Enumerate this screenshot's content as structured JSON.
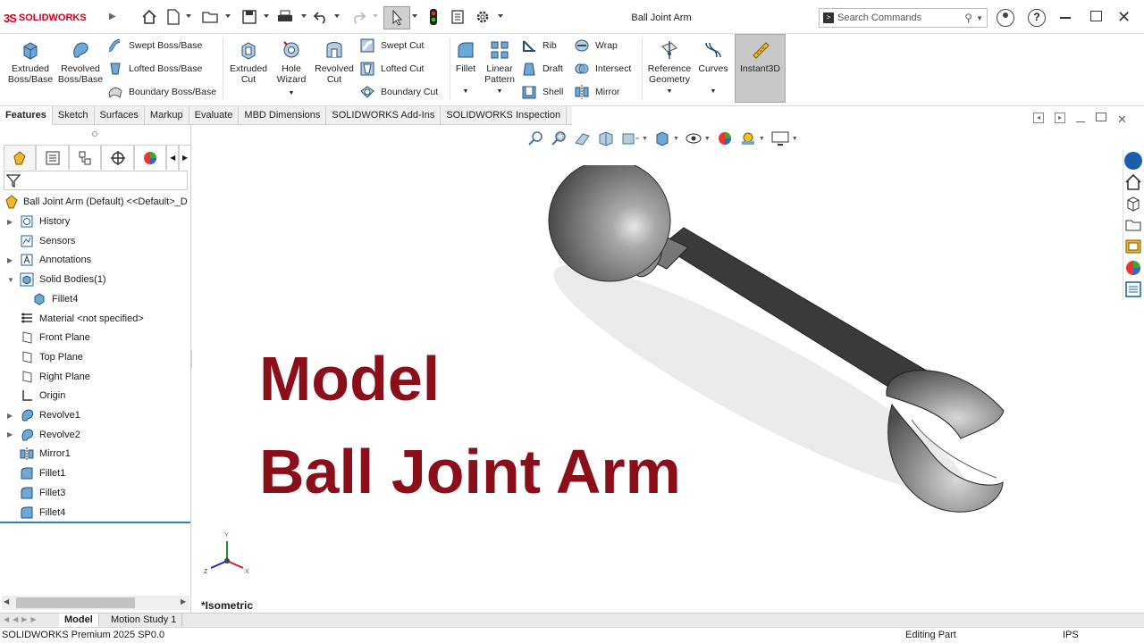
{
  "titlebar": {
    "brand_prefix": "3S",
    "brand_name": "SOLIDWORKS",
    "title": "Ball Joint Arm",
    "search_placeholder": "Search Commands"
  },
  "ribbon": {
    "big": [
      {
        "label1": "Extruded",
        "label2": "Boss/Base"
      },
      {
        "label1": "Revolved",
        "label2": "Boss/Base"
      },
      {
        "label1": "Extruded",
        "label2": "Cut"
      },
      {
        "label1": "Hole",
        "label2": "Wizard"
      },
      {
        "label1": "Revolved",
        "label2": "Cut"
      },
      {
        "label1": "Fillet",
        "label2": ""
      },
      {
        "label1": "Linear",
        "label2": "Pattern"
      },
      {
        "label1": "Reference",
        "label2": "Geometry"
      },
      {
        "label1": "Curves",
        "label2": ""
      },
      {
        "label1": "Instant3D",
        "label2": ""
      }
    ],
    "small": {
      "swept_boss": "Swept Boss/Base",
      "lofted_boss": "Lofted Boss/Base",
      "boundary_boss": "Boundary Boss/Base",
      "swept_cut": "Swept Cut",
      "lofted_cut": "Lofted Cut",
      "boundary_cut": "Boundary Cut",
      "rib": "Rib",
      "draft": "Draft",
      "shell": "Shell",
      "wrap": "Wrap",
      "intersect": "Intersect",
      "mirror": "Mirror"
    }
  },
  "tabs": [
    "Features",
    "Sketch",
    "Surfaces",
    "Markup",
    "Evaluate",
    "MBD Dimensions",
    "SOLIDWORKS Add-Ins",
    "SOLIDWORKS Inspection"
  ],
  "tree": {
    "root": "Ball Joint Arm (Default) <<Default>_D",
    "items": [
      {
        "label": "History",
        "icon": "history-icon",
        "expandable": true
      },
      {
        "label": "Sensors",
        "icon": "sensors-icon",
        "expandable": false
      },
      {
        "label": "Annotations",
        "icon": "annotations-icon",
        "expandable": true
      },
      {
        "label": "Solid Bodies(1)",
        "icon": "solid-bodies-icon",
        "expandable": true,
        "expanded": true
      },
      {
        "label": "Fillet4",
        "icon": "body-icon",
        "expandable": false,
        "child": true
      },
      {
        "label": "Material <not specified>",
        "icon": "material-icon",
        "expandable": false
      },
      {
        "label": "Front Plane",
        "icon": "plane-icon",
        "expandable": false
      },
      {
        "label": "Top Plane",
        "icon": "plane-icon",
        "expandable": false
      },
      {
        "label": "Right Plane",
        "icon": "plane-icon",
        "expandable": false
      },
      {
        "label": "Origin",
        "icon": "origin-icon",
        "expandable": false
      },
      {
        "label": "Revolve1",
        "icon": "revolve-icon",
        "expandable": true
      },
      {
        "label": "Revolve2",
        "icon": "revolve-icon",
        "expandable": true
      },
      {
        "label": "Mirror1",
        "icon": "mirror-icon",
        "expandable": false
      },
      {
        "label": "Fillet1",
        "icon": "fillet-icon",
        "expandable": false
      },
      {
        "label": "Fillet3",
        "icon": "fillet-icon",
        "expandable": false
      },
      {
        "label": "Fillet4",
        "icon": "fillet-icon",
        "expandable": false
      }
    ]
  },
  "viewport": {
    "overlay_line1": "Model",
    "overlay_line2": "Ball Joint Arm",
    "view_label": "*Isometric",
    "triad_x": "X",
    "triad_y": "Y",
    "triad_z": "Z"
  },
  "bottom_tabs": [
    "Model",
    "Motion Study 1"
  ],
  "status": {
    "product": "SOLIDWORKS Premium 2025 SP0.0",
    "mode": "Editing Part",
    "units": "IPS"
  },
  "colors": {
    "brand_red": "#d4001a",
    "overlay_text": "#8b0f1a",
    "model_gray": "#8a8a8a"
  }
}
